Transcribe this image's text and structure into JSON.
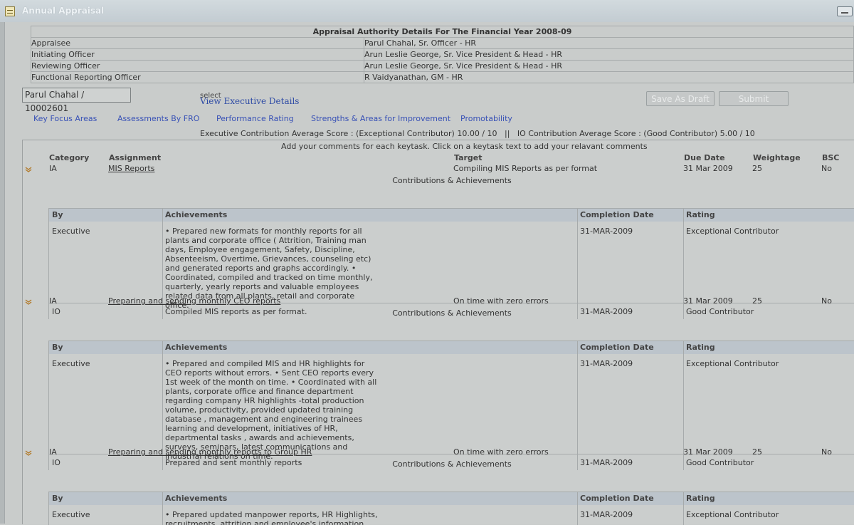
{
  "window": {
    "title": "Annual Appraisal"
  },
  "authority": {
    "heading": "Appraisal Authority Details For The  Financial Year 2008-09",
    "rows": [
      {
        "label": "Appraisee",
        "value": "Parul Chahal, Sr. Officer - HR"
      },
      {
        "label": "Initiating Officer",
        "value": "Arun Leslie George, Sr. Vice President & Head - HR"
      },
      {
        "label": "Reviewing Officer",
        "value": "Arun Leslie George, Sr. Vice President & Head - HR"
      },
      {
        "label": "Functional Reporting Officer",
        "value": "R Vaidyanathan, GM - HR"
      }
    ]
  },
  "employee_field": {
    "value": "Parul Chahal / 10002601"
  },
  "select_label": "select",
  "view_exec_link": "View Executive Details",
  "buttons": {
    "save_draft": "Save As Draft",
    "submit": "Submit"
  },
  "nav": [
    "Key Focus Areas",
    "Assessments By FRO",
    "Performance Rating",
    "Strengths & Areas for Improvement",
    "Promotability"
  ],
  "scores": {
    "line": "Executive Contribution Average Score : (Exceptional Contributor) 10.00 / 10   ||   IO Contribution Average Score : (Good Contributor) 5.00 / 10"
  },
  "grid": {
    "instruction": "Add your comments for each keytask. Click on a keytask text to add your relavant comments",
    "headers": {
      "category": "Category",
      "assignment": "Assignment",
      "target": "Target",
      "due_date": "Due Date",
      "weightage": "Weightage",
      "bsc": "BSC"
    },
    "contrib_title": "Contributions & Achievements",
    "sub_headers": {
      "by": "By",
      "achievements": "Achievements",
      "completion": "Completion Date",
      "rating": "Rating"
    },
    "tasks": [
      {
        "category": "IA",
        "assignment": "MIS Reports",
        "target": "Compiling MIS Reports as per format",
        "due": "31 Mar 2009",
        "weight": "25",
        "bsc": "No",
        "exec": {
          "by": "Executive",
          "text": "• Prepared new formats for monthly reports for all plants and corporate office ( Attrition, Training man days, Employee engagement, Safety, Discipline, Absenteeism, Overtime, Grievances, counseling etc) and generated reports and graphs accordingly. • Coordinated, compiled and tracked on time monthly, quarterly, yearly reports and valuable employees related data from all plants, retail and corporate office.",
          "date": "31-MAR-2009",
          "rating": "Exceptional Contributor"
        },
        "io": {
          "by": "IO",
          "text": "Compiled MIS reports as per format.",
          "date": "31-MAR-2009",
          "rating": "Good Contributor"
        }
      },
      {
        "category": "IA",
        "assignment": "Preparing and sending monthly CEO reports",
        "target": "On time with zero errors",
        "due": "31 Mar 2009",
        "weight": "25",
        "bsc": "No",
        "exec": {
          "by": "Executive",
          "text": "• Prepared and compiled MIS and HR highlights for CEO reports without errors. • Sent CEO reports every 1st week of the month on time. • Coordinated with all plants, corporate office and finance department regarding company HR highlights -total production volume, productivity, provided updated training database , management and engineering trainees learning and development, initiatives of HR, departmental tasks , awards and achievements, surveys, seminars, latest communications and industrial relations on time.",
          "date": "31-MAR-2009",
          "rating": "Exceptional Contributor"
        },
        "io": {
          "by": "IO",
          "text": "Prepared and sent monthly reports",
          "date": "31-MAR-2009",
          "rating": "Good Contributor"
        }
      },
      {
        "category": "IA",
        "assignment": "Preparing and sending monthly reports to Group HR",
        "target": "On time with zero errors",
        "due": "31 Mar 2009",
        "weight": "25",
        "bsc": "No",
        "exec": {
          "by": "Executive",
          "text": "• Prepared updated manpower reports, HR Highlights, recruitments, attrition and employee's information data which was sent monthly, quarterly and yearly. All the reports were error free and sent on time.",
          "date": "31-MAR-2009",
          "rating": "Exceptional Contributor"
        }
      }
    ]
  }
}
